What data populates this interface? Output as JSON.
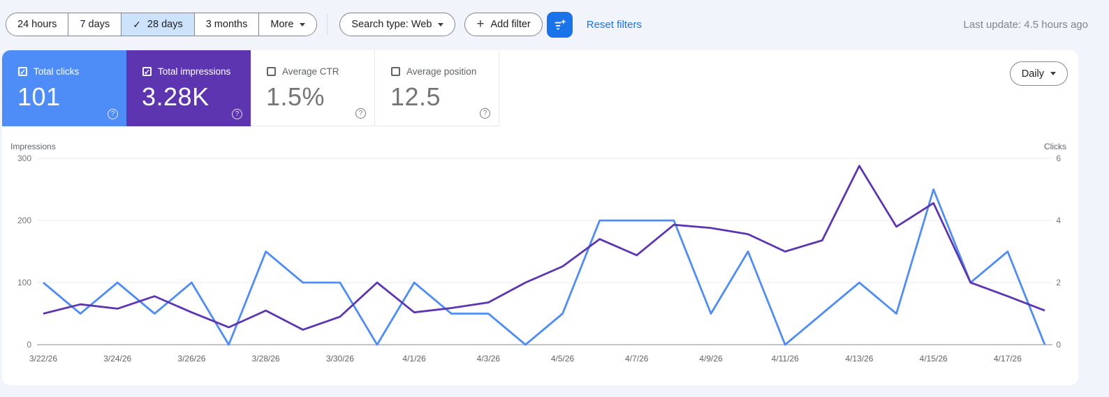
{
  "toolbar": {
    "date_ranges": [
      {
        "label": "24 hours",
        "selected": false
      },
      {
        "label": "7 days",
        "selected": false
      },
      {
        "label": "28 days",
        "selected": true
      },
      {
        "label": "3 months",
        "selected": false
      },
      {
        "label": "More",
        "selected": false,
        "has_dropdown": true
      }
    ],
    "search_type": "Search type: Web",
    "add_filter": "Add filter",
    "reset_filters": "Reset filters",
    "last_update": "Last update: 4.5 hours ago",
    "filter_button_color": "#1a73e8"
  },
  "metrics": [
    {
      "label": "Total clicks",
      "value": "101",
      "checked": true,
      "color": "#4e8df7"
    },
    {
      "label": "Total impressions",
      "value": "3.28K",
      "checked": true,
      "color": "#5e35b1"
    },
    {
      "label": "Average CTR",
      "value": "1.5%",
      "checked": false
    },
    {
      "label": "Average position",
      "value": "12.5",
      "checked": false
    }
  ],
  "granularity": {
    "label": "Daily"
  },
  "chart_data": {
    "type": "line",
    "x": [
      "3/22/26",
      "3/23/26",
      "3/24/26",
      "3/25/26",
      "3/26/26",
      "3/27/26",
      "3/28/26",
      "3/29/26",
      "3/30/26",
      "3/31/26",
      "4/1/26",
      "4/2/26",
      "4/3/26",
      "4/4/26",
      "4/5/26",
      "4/6/26",
      "4/7/26",
      "4/8/26",
      "4/9/26",
      "4/10/26",
      "4/11/26",
      "4/12/26",
      "4/13/26",
      "4/14/26",
      "4/15/26",
      "4/16/26",
      "4/17/26",
      "4/18/26"
    ],
    "x_axis_labels": [
      "3/22/26",
      "3/24/26",
      "3/26/26",
      "3/28/26",
      "3/30/26",
      "4/1/26",
      "4/3/26",
      "4/5/26",
      "4/7/26",
      "4/9/26",
      "4/11/26",
      "4/13/26",
      "4/15/26",
      "4/17/26"
    ],
    "series": [
      {
        "name": "Clicks",
        "axis": "right",
        "color": "#4e8df7",
        "values": [
          2,
          1,
          2,
          1,
          2,
          0,
          3,
          2,
          2,
          0,
          2,
          1,
          1,
          0,
          1,
          4,
          4,
          4,
          1,
          3,
          0,
          1,
          2,
          1,
          5,
          2,
          3,
          0
        ]
      },
      {
        "name": "Impressions",
        "axis": "left",
        "color": "#5e35b1",
        "values": [
          50,
          65,
          58,
          78,
          52,
          28,
          55,
          24,
          45,
          100,
          52,
          59,
          68,
          100,
          126,
          170,
          144,
          193,
          188,
          178,
          150,
          168,
          288,
          190,
          228,
          100,
          78,
          55
        ]
      }
    ],
    "left_axis": {
      "label": "Impressions",
      "ticks": [
        300,
        200,
        100,
        0
      ],
      "ylim": [
        0,
        300
      ]
    },
    "right_axis": {
      "label": "Clicks",
      "ticks": [
        6,
        4,
        2,
        0
      ],
      "ylim": [
        0,
        6
      ]
    },
    "grid": "horizontal",
    "legend_position": "none"
  }
}
